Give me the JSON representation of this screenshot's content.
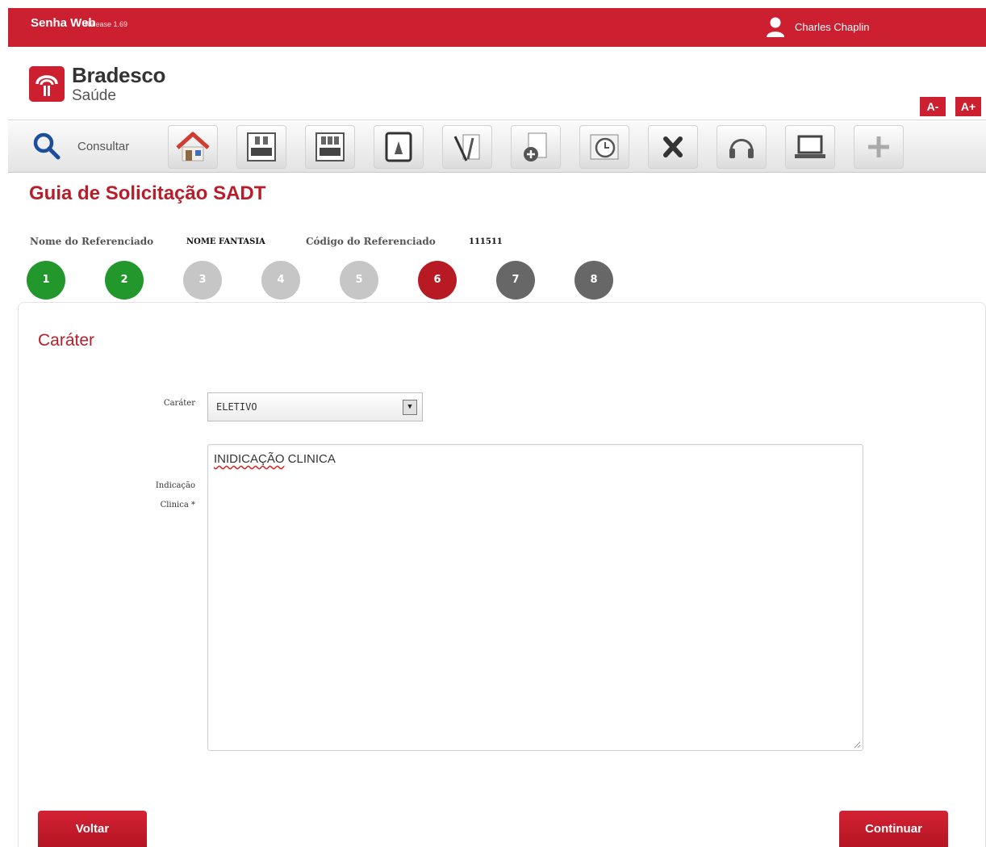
{
  "header": {
    "app_name": "Senha Web",
    "release": "Release 1.69",
    "user_name": "Charles Chaplin"
  },
  "brand": {
    "name": "Bradesco",
    "sub": "Saúde"
  },
  "font_controls": {
    "decrease": "A-",
    "increase": "A+"
  },
  "toolbar": {
    "consult_label": "Consultar",
    "tools": [
      "home-icon",
      "cash-register-icon",
      "cash-register-double-icon",
      "document-icon",
      "tools-icon",
      "medical-bag-icon",
      "clock-icon",
      "close-icon",
      "headset-icon",
      "laptop-icon",
      "plus-icon"
    ]
  },
  "page": {
    "title": "Guia de Solicitação SADT",
    "ref_name_label": "Nome do Referenciado",
    "ref_name_value": "NOME FANTASIA",
    "ref_code_label": "Código do Referenciado",
    "ref_code_value": "111511"
  },
  "steps": [
    {
      "num": "1",
      "state": "done"
    },
    {
      "num": "2",
      "state": "done"
    },
    {
      "num": "3",
      "state": "disabled"
    },
    {
      "num": "4",
      "state": "disabled"
    },
    {
      "num": "5",
      "state": "disabled"
    },
    {
      "num": "6",
      "state": "current"
    },
    {
      "num": "7",
      "state": "next"
    },
    {
      "num": "8",
      "state": "next"
    }
  ],
  "form": {
    "section_title": "Caráter",
    "carater_label": "Caráter",
    "carater_value": "ELETIVO",
    "indicacao_label_line1": "Indicação",
    "indicacao_label_line2": "Clinica *",
    "indicacao_spell": "INIDICAÇÃO",
    "indicacao_rest": " CLINICA"
  },
  "buttons": {
    "back": "Voltar",
    "next": "Continuar"
  },
  "colors": {
    "brand_red": "#cc1f2f",
    "step_done": "#22972c",
    "step_disabled": "#c6c6c6",
    "step_current": "#b81a23",
    "step_next": "#676767"
  }
}
